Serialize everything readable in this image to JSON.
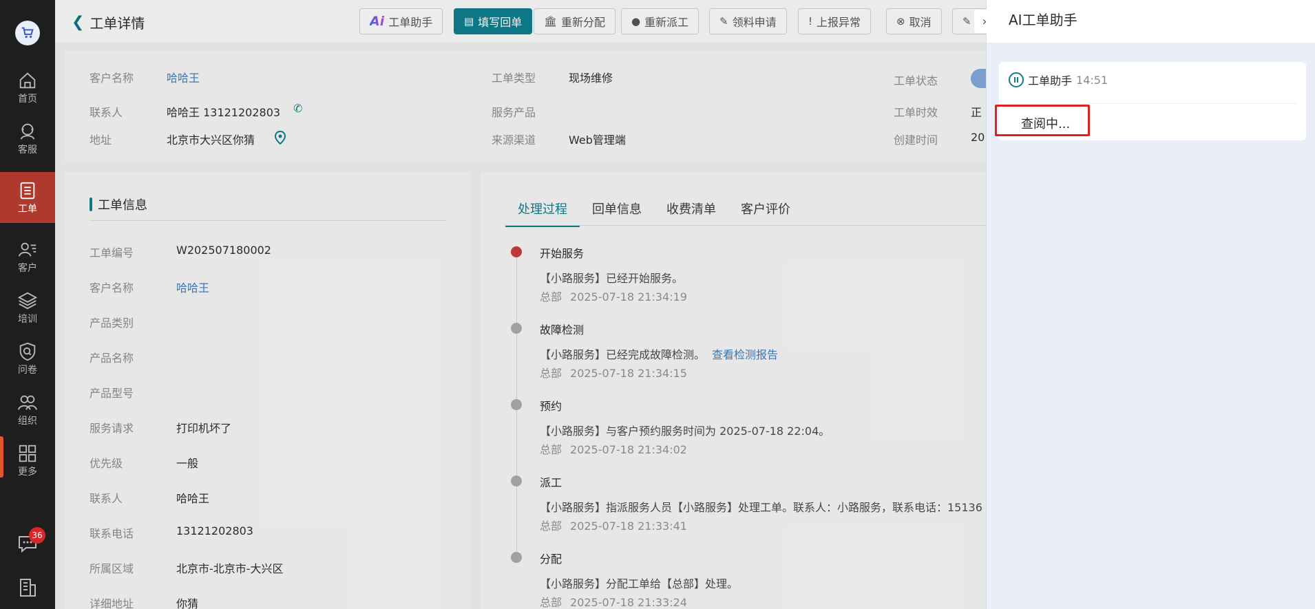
{
  "nav": {
    "items": [
      {
        "label": "首页",
        "icon": "home-icon"
      },
      {
        "label": "客服",
        "icon": "headset-icon"
      },
      {
        "label": "工单",
        "icon": "ticket-icon",
        "active": true
      },
      {
        "label": "客户",
        "icon": "customer-icon"
      },
      {
        "label": "培训",
        "icon": "layers-icon"
      },
      {
        "label": "问卷",
        "icon": "survey-shield-icon"
      },
      {
        "label": "组织",
        "icon": "group-icon"
      },
      {
        "label": "更多",
        "icon": "grid-icon"
      }
    ],
    "chat_badge": "36",
    "accent": "#b0392d"
  },
  "header": {
    "title": "工单详情",
    "actions": {
      "ai_helper": "工单助手",
      "fill_reply": "填写回单",
      "reassign": "重新分配",
      "redispatch": "重新派工",
      "material": "领料申请",
      "report_issue": "上报异常",
      "cancel": "取消"
    }
  },
  "summary": {
    "customer_label": "客户名称",
    "customer": "哈哈王",
    "contact_label": "联系人",
    "contact": "哈哈王 13121202803",
    "address_label": "地址",
    "address": "北京市大兴区你猜",
    "type_label": "工单类型",
    "type": "现场维修",
    "product_label": "服务产品",
    "channel_label": "来源渠道",
    "channel": "Web管理端",
    "status_label": "工单状态",
    "timeliness_label": "工单时效",
    "timeliness_partial": "正",
    "created_label": "创建时间",
    "created_partial": "20"
  },
  "info": {
    "section_title": "工单信息",
    "rows": [
      {
        "label": "工单编号",
        "value": "W202507180002"
      },
      {
        "label": "客户名称",
        "value": "哈哈王",
        "link": true
      },
      {
        "label": "产品类别",
        "value": ""
      },
      {
        "label": "产品名称",
        "value": ""
      },
      {
        "label": "产品型号",
        "value": ""
      },
      {
        "label": "服务请求",
        "value": "打印机坏了"
      },
      {
        "label": "优先级",
        "value": "一般"
      },
      {
        "label": "联系人",
        "value": "哈哈王"
      },
      {
        "label": "联系电话",
        "value": "13121202803"
      },
      {
        "label": "所属区域",
        "value": "北京市-北京市-大兴区"
      },
      {
        "label": "详细地址",
        "value": "你猜"
      }
    ]
  },
  "process": {
    "tabs": [
      "处理过程",
      "回单信息",
      "收费清单",
      "客户评价"
    ],
    "active_tab": 0,
    "events": [
      {
        "title": "开始服务",
        "desc": "【小路服务】已经开始服务。",
        "link": "",
        "org": "总部",
        "time": "2025-07-18 21:34:19",
        "color": "red"
      },
      {
        "title": "故障检测",
        "desc": "【小路服务】已经完成故障检测。",
        "link": "查看检测报告",
        "org": "总部",
        "time": "2025-07-18 21:34:15",
        "color": "gray"
      },
      {
        "title": "预约",
        "desc": "【小路服务】与客户预约服务时间为 2025-07-18 22:04。",
        "link": "",
        "org": "总部",
        "time": "2025-07-18 21:34:02",
        "color": "gray"
      },
      {
        "title": "派工",
        "desc": "【小路服务】指派服务人员【小路服务】处理工单。联系人：小路服务，联系电话：15136",
        "link": "",
        "org": "总部",
        "time": "2025-07-18 21:33:41",
        "color": "gray"
      },
      {
        "title": "分配",
        "desc": "【小路服务】分配工单给【总部】处理。",
        "link": "",
        "org": "总部",
        "time": "2025-07-18 21:33:24",
        "color": "gray"
      }
    ]
  },
  "assistant": {
    "title": "AI工单助手",
    "message_sender": "工单助手",
    "message_time": "14:51",
    "message_text": "查阅中..."
  }
}
